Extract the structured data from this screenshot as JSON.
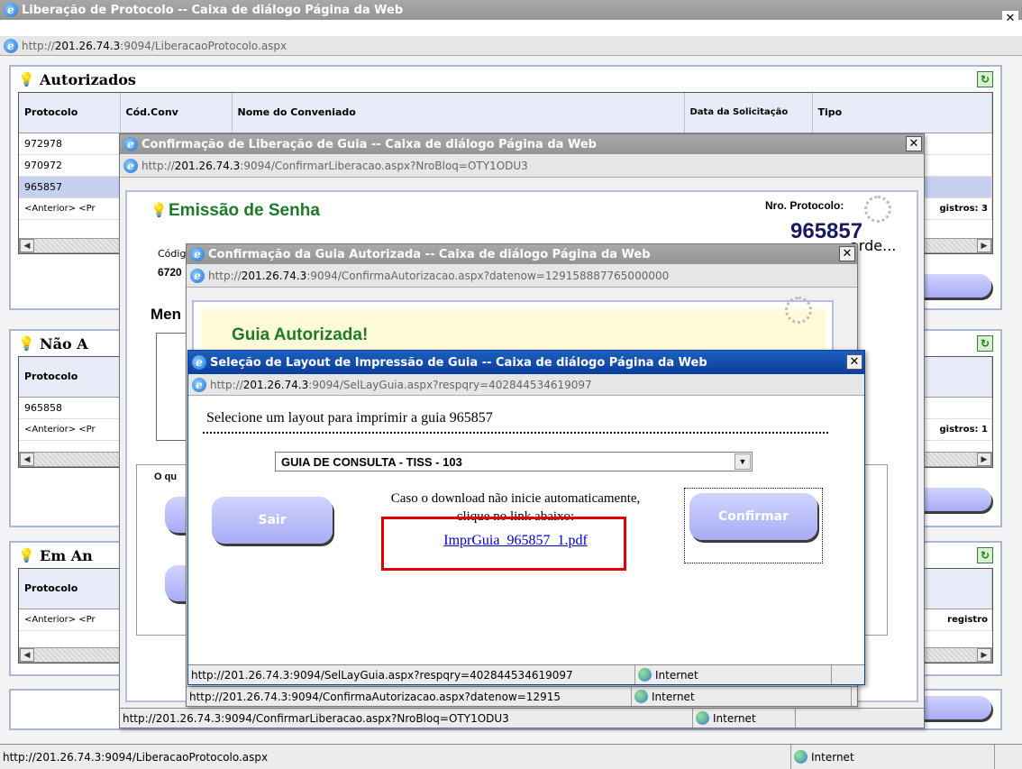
{
  "main": {
    "title": "Liberação de Protocolo -- Caixa de diálogo Página da Web",
    "url_prefix": "http://",
    "url_host": "201.26.74.3",
    "url_rest": ":9094/LiberacaoProtocolo.aspx",
    "status_url": "http://201.26.74.3:9094/LiberacaoProtocolo.aspx",
    "status_zone": "Internet",
    "autorizados": {
      "title": "Autorizados",
      "columns": [
        "Protocolo",
        "Cód.Conv",
        "Nome do Conveniado",
        "Data da Solicitação",
        "Tipo"
      ],
      "rows": [
        "972978",
        "970972",
        "965857"
      ],
      "pager": "<Anterior> <Pr",
      "registros": "gistros: 3"
    },
    "nao_autorizados": {
      "title": "Não A",
      "columns": [
        "Protocolo"
      ],
      "rows": [
        "965858"
      ],
      "pager": "<Anterior> <Pr",
      "registros": "gistros: 1"
    },
    "em_analise": {
      "title": "Em An",
      "columns": [
        "Protocolo"
      ],
      "pager": "<Anterior> <Pr",
      "registros": "registro"
    }
  },
  "confirm_lib": {
    "title": "Confirmação de Liberação de Guia -- Caixa de diálogo Página da Web",
    "url_prefix": "http://",
    "url_host": "201.26.74.3",
    "url_rest": ":9094/ConfirmarLiberacao.aspx?NroBloq=OTY1ODU3",
    "heading": "Emissão de Senha",
    "nro_protocolo_label": "Nro. Protocolo:",
    "nro_protocolo_value": "965857",
    "codigo_label": "Códig",
    "codigo_value": "6720",
    "aguarde": "arde...",
    "mensagem_label": "Men",
    "oque_label": "O qu",
    "status_url": "http://201.26.74.3:9094/ConfirmarLiberacao.aspx?NroBloq=OTY1ODU3",
    "status_zone": "Internet"
  },
  "confirm_guia": {
    "title": "Confirmação da Guia Autorizada -- Caixa de diálogo Página da Web",
    "url_prefix": "http://",
    "url_host": "201.26.74.3",
    "url_rest": ":9094/ConfirmaAutorizacao.aspx?datenow=129158887765000000",
    "heading": "Guia Autorizada!",
    "status_url": "http://201.26.74.3:9094/ConfirmaAutorizacao.aspx?datenow=12915",
    "status_zone": "Internet"
  },
  "layout_dialog": {
    "title": "Seleção de Layout de Impressão de Guia -- Caixa de diálogo Página da Web",
    "url_prefix": "http://",
    "url_host": "201.26.74.3",
    "url_rest": ":9094/SelLayGuia.aspx?respqry=402844534619097",
    "prompt": "Selecione um layout para imprimir a guia 965857",
    "select_value": "GUIA DE CONSULTA - TISS - 103",
    "download_line1": "Caso o download não inicie automaticamente,",
    "download_line2": "clique no link abaixo:",
    "link_text": "ImprGuia_965857_1.pdf",
    "sair_label": "Sair",
    "confirmar_label": "Confirmar",
    "status_url": "http://201.26.74.3:9094/SelLayGuia.aspx?respqry=402844534619097",
    "status_zone": "Internet"
  },
  "colors": {
    "highlight_box": "#e00000",
    "pill_button": "#a8acf5",
    "active_title": "#0a3e9b"
  }
}
